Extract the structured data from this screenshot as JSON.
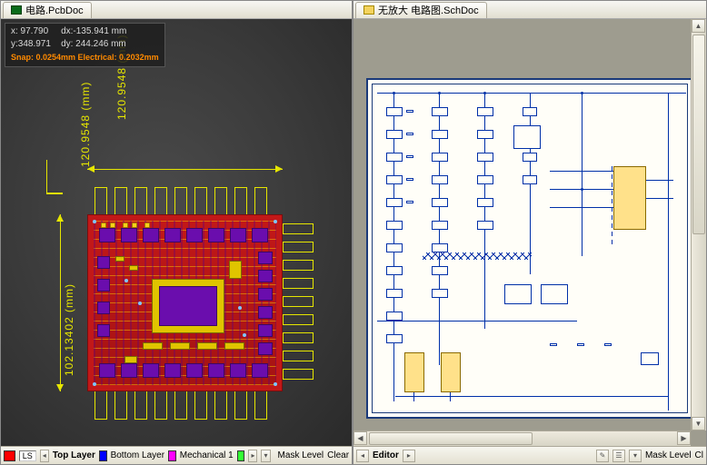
{
  "left": {
    "tab": {
      "label": "电路.PcbDoc"
    },
    "coords": {
      "line1_left": "x: 97.790",
      "line1_right": "dx:-135.941  mm",
      "line2_left": "y:348.971",
      "line2_right": "dy: 244.246    mm",
      "snap": "Snap: 0.0254mm  Electrical: 0.2032mm"
    },
    "dims": {
      "width_label": "120.9548 (mm)",
      "height_label": "102.13402 (mm)"
    },
    "status": {
      "ls": "LS",
      "layer1": "Top Layer",
      "layer2": "Bottom Layer",
      "layer3": "Mechanical 1",
      "masklevel": "Mask Level",
      "clear": "Clear"
    }
  },
  "right": {
    "tab": {
      "label": "无放大 电路图.SchDoc"
    },
    "status": {
      "editor": "Editor",
      "masklevel": "Mask Level",
      "clear": "Cl"
    }
  }
}
